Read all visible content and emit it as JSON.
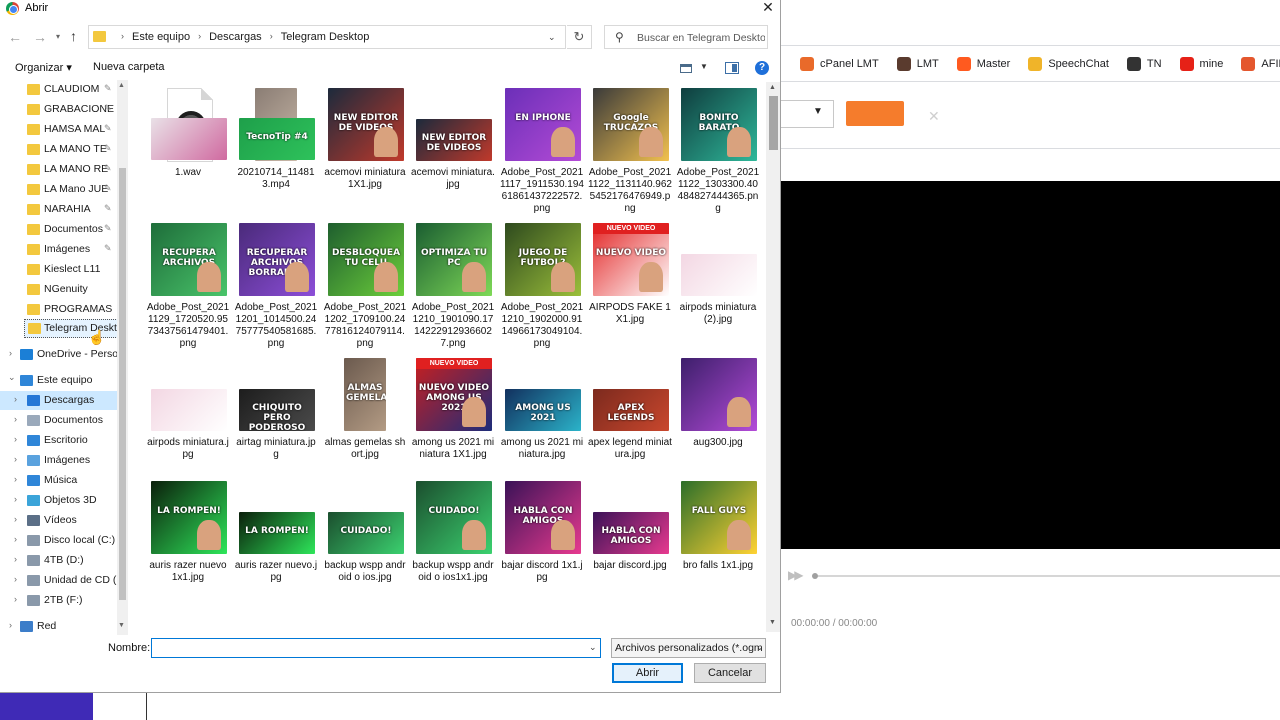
{
  "background": {
    "bookmarks": [
      {
        "label": "cPanel LMT",
        "icon": "cpanel-icon",
        "color": "#e96a2a"
      },
      {
        "label": "LMT",
        "icon": "lmt-icon",
        "color": "#5a3b2e"
      },
      {
        "label": "Master",
        "icon": "master-icon",
        "color": "#ff5a1f"
      },
      {
        "label": "SpeechChat",
        "icon": "speechchat-icon",
        "color": "#f0b429"
      },
      {
        "label": "TN",
        "icon": "tn-icon",
        "color": "#333333"
      },
      {
        "label": "mine",
        "icon": "youtube-icon",
        "color": "#e62117"
      },
      {
        "label": "AFIL BANG",
        "icon": "bg-icon",
        "color": "#e4572e"
      }
    ],
    "time": "00:00:00 / 00:00:00",
    "accent_color": "#f57c2c"
  },
  "dialog": {
    "title": "Abrir",
    "breadcrumbs": [
      "Este equipo",
      "Descargas",
      "Telegram Desktop"
    ],
    "search_placeholder": "Buscar en Telegram Desktop",
    "organize_label": "Organizar ▾",
    "new_folder_label": "Nueva carpeta",
    "nav_items": [
      {
        "label": "CLAUDIOM",
        "pinned": true
      },
      {
        "label": "GRABACIONE",
        "pinned": true
      },
      {
        "label": "HAMSA MAL",
        "pinned": true
      },
      {
        "label": "LA MANO TE",
        "pinned": true
      },
      {
        "label": "LA MANO RE",
        "pinned": true
      },
      {
        "label": "LA Mano JUE",
        "pinned": true
      },
      {
        "label": "NARAHIA",
        "pinned": true
      },
      {
        "label": "Documentos",
        "pinned": true
      },
      {
        "label": "Imágenes",
        "pinned": true
      },
      {
        "label": "Kieslect L11",
        "pinned": false
      },
      {
        "label": "NGenuity",
        "pinned": false
      },
      {
        "label": "PROGRAMAS",
        "pinned": false
      },
      {
        "label": "Telegram Desktop",
        "pinned": false
      },
      {
        "label": "OneDrive - Persor",
        "pinned": false
      },
      {
        "label": "Este equipo",
        "pinned": false
      },
      {
        "label": "Descargas",
        "pinned": false
      },
      {
        "label": "Documentos",
        "pinned": false
      },
      {
        "label": "Escritorio",
        "pinned": false
      },
      {
        "label": "Imágenes",
        "pinned": false
      },
      {
        "label": "Música",
        "pinned": false
      },
      {
        "label": "Objetos 3D",
        "pinned": false
      },
      {
        "label": "Vídeos",
        "pinned": false
      },
      {
        "label": "Disco local (C:)",
        "pinned": false
      },
      {
        "label": "4TB (D:)",
        "pinned": false
      },
      {
        "label": "Unidad de CD (E",
        "pinned": false
      },
      {
        "label": "2TB (F:)",
        "pinned": false
      },
      {
        "label": "Red",
        "pinned": false
      }
    ],
    "files": [
      {
        "name": "1.wav",
        "kind": "wav"
      },
      {
        "name": "20210714_114813.mp4",
        "kind": "img",
        "colors": [
          "#8a7d74",
          "#c9b8a8"
        ],
        "caption": ""
      },
      {
        "name": "acemovi miniatura 1X1.jpg",
        "kind": "img",
        "colors": [
          "#1c2a3c",
          "#c0392b"
        ],
        "caption": "NEW EDITOR DE VIDEOS"
      },
      {
        "name": "acemovi miniatura.jpg",
        "kind": "img",
        "colors": [
          "#1c2a3c",
          "#c0392b"
        ],
        "caption": "NEW EDITOR DE VIDEOS"
      },
      {
        "name": "Adobe_Post_20211117_1911530.19461861437222572.png",
        "kind": "img",
        "colors": [
          "#6b2fb8",
          "#b44bd6"
        ],
        "caption": "EN IPHONE"
      },
      {
        "name": "Adobe_Post_20211122_1131140.9625452176476949.png",
        "kind": "img",
        "colors": [
          "#3a3a3a",
          "#f2c14e"
        ],
        "caption": "Google TRUCAZOS"
      },
      {
        "name": "Adobe_Post_20211122_1303300.40484827444365.png",
        "kind": "img",
        "colors": [
          "#0f3d3e",
          "#2fb89a"
        ],
        "caption": "BONITO BARATO"
      },
      {
        "name": "Adobe_Post_20211129_1720520.9573437561479401.png",
        "kind": "img",
        "colors": [
          "#1e6d3a",
          "#49c46a"
        ],
        "caption": "RECUPERA ARCHIVOS"
      },
      {
        "name": "Adobe_Post_20211201_1014500.2475777540581685.png",
        "kind": "img",
        "colors": [
          "#4a2a7a",
          "#8c4ed8"
        ],
        "caption": "RECUPERAR ARCHIVOS BORRADOS"
      },
      {
        "name": "Adobe_Post_20211202_1709100.2477816124079114.png",
        "kind": "img",
        "colors": [
          "#1e5e2e",
          "#6ccf3b"
        ],
        "caption": "DESBLOQUEA TU CELU"
      },
      {
        "name": "Adobe_Post_20211210_1901090.17142229129366027.png",
        "kind": "img",
        "colors": [
          "#1a5d31",
          "#7ed957"
        ],
        "caption": "OPTIMIZA TU PC"
      },
      {
        "name": "Adobe_Post_20211210_1902000.9114966173049104.png",
        "kind": "img",
        "colors": [
          "#2e4a1e",
          "#9bbf3a"
        ],
        "caption": "JUEGO DE FUTBOL?"
      },
      {
        "name": "AIRPODS FAKE 1X1.jpg",
        "kind": "img",
        "colors": [
          "#e32626",
          "#ffffff"
        ],
        "caption": "NUEVO VIDEO"
      },
      {
        "name": "airpods miniatura (2).jpg",
        "kind": "img",
        "colors": [
          "#f3d7e3",
          "#ffffff"
        ],
        "caption": ""
      },
      {
        "name": "airpods miniatura.jpg",
        "kind": "img",
        "colors": [
          "#f3d7e3",
          "#ffffff"
        ],
        "caption": ""
      },
      {
        "name": "airtag miniatura.jpg",
        "kind": "img",
        "colors": [
          "#1d1d1d",
          "#4b4b4b"
        ],
        "caption": "CHIQUITO PERO PODEROSO"
      },
      {
        "name": "almas gemelas short.jpg",
        "kind": "img",
        "colors": [
          "#6b5a4e",
          "#b39b84"
        ],
        "caption": "ALMAS GEMELAS"
      },
      {
        "name": "among us 2021 miniatura 1X1.jpg",
        "kind": "img",
        "colors": [
          "#c81f1f",
          "#1d2c7a"
        ],
        "caption": "NUEVO VIDEO AMONG US 2021"
      },
      {
        "name": "among us 2021 miniatura.jpg",
        "kind": "img",
        "colors": [
          "#12305e",
          "#2bb3c9"
        ],
        "caption": "AMONG US 2021"
      },
      {
        "name": "apex legend miniatura.jpg",
        "kind": "img",
        "colors": [
          "#7c2a1e",
          "#c9472d"
        ],
        "caption": "APEX LEGENDS"
      },
      {
        "name": "aug300.jpg",
        "kind": "img",
        "colors": [
          "#3d1f6b",
          "#b34bd8"
        ],
        "caption": ""
      },
      {
        "name": "auris razer nuevo 1x1.jpg",
        "kind": "img",
        "colors": [
          "#0b1f0b",
          "#2ee65a"
        ],
        "caption": "LA ROMPEN!"
      },
      {
        "name": "auris razer nuevo.jpg",
        "kind": "img",
        "colors": [
          "#0b1f0b",
          "#2ee65a"
        ],
        "caption": "LA ROMPEN!"
      },
      {
        "name": "backup wspp android o ios.jpg",
        "kind": "img",
        "colors": [
          "#1b4e2e",
          "#3bd16f"
        ],
        "caption": "CUIDADO!"
      },
      {
        "name": "backup wspp android o ios1x1.jpg",
        "kind": "img",
        "colors": [
          "#1b4e2e",
          "#3bd16f"
        ],
        "caption": "CUIDADO!"
      },
      {
        "name": "bajar discord 1x1.jpg",
        "kind": "img",
        "colors": [
          "#3a1257",
          "#e73a8f"
        ],
        "caption": "HABLA CON AMIGOS"
      },
      {
        "name": "bajar discord.jpg",
        "kind": "img",
        "colors": [
          "#3a1257",
          "#e73a8f"
        ],
        "caption": "HABLA CON AMIGOS"
      },
      {
        "name": "bro falls 1x1.jpg",
        "kind": "img",
        "colors": [
          "#2c6e2a",
          "#ffd233"
        ],
        "caption": "FALL GUYS"
      },
      {
        "name": "",
        "kind": "img",
        "colors": [
          "#e9e1e7",
          "#d06aa0"
        ],
        "caption": ""
      },
      {
        "name": "",
        "kind": "img",
        "colors": [
          "#1e9f4a",
          "#2ec25b"
        ],
        "caption": "TecnoTip #4"
      }
    ],
    "filename_label": "Nombre:",
    "filename_value": "",
    "filetype_value": "Archivos personalizados (*.ogm",
    "open_label": "Abrir",
    "cancel_label": "Cancelar"
  }
}
